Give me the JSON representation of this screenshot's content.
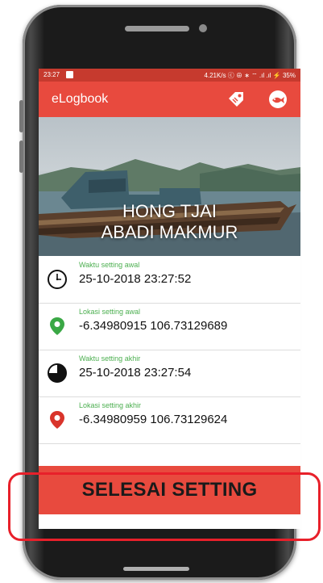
{
  "status_bar": {
    "time": "23:27",
    "indicators": "4.21K/s ⓒ ⊕ ∗ ⌔ .ıl .ıl ⚡ 35%"
  },
  "app_bar": {
    "title": "eLogbook",
    "icons": [
      "tag-icon",
      "fish-icon"
    ]
  },
  "hero": {
    "vessel_name_line1": "HONG TJAI",
    "vessel_name_line2": "ABADI MAKMUR"
  },
  "details": [
    {
      "label": "Waktu setting awal",
      "value": "25-10-2018 23:27:52",
      "icon": "clock-icon"
    },
    {
      "label": "Lokasi setting awal",
      "value": "-6.34980915 106.73129689",
      "icon": "location-pin-green-icon"
    },
    {
      "label": "Waktu setting akhir",
      "value": "25-10-2018 23:27:54",
      "icon": "clock-progress-icon"
    },
    {
      "label": "Lokasi setting akhir",
      "value": "-6.34980959 106.73129624",
      "icon": "location-pin-red-icon"
    }
  ],
  "action": {
    "finish_label": "SELESAI SETTING"
  },
  "colors": {
    "app_bar": "#e84a3e",
    "status_bar": "#c63a2e",
    "label_green": "#4caf50",
    "pin_red": "#d9342b",
    "highlight": "#e8202a"
  }
}
